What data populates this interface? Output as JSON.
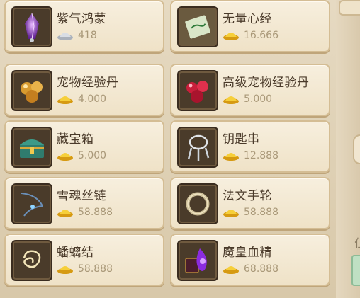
{
  "items": [
    {
      "name": "紫气鸿蒙",
      "price": "418",
      "currency": "silver",
      "icon": "purple-crystal-icon"
    },
    {
      "name": "无量心经",
      "price": "16.666",
      "currency": "gold",
      "icon": "scripture-scroll-icon"
    },
    {
      "name": "宠物经验丹",
      "price": "4.000",
      "currency": "gold",
      "icon": "gold-pills-icon"
    },
    {
      "name": "高级宠物经验丹",
      "price": "5.000",
      "currency": "gold",
      "icon": "red-pills-icon"
    },
    {
      "name": "藏宝箱",
      "price": "5.000",
      "currency": "gold",
      "icon": "treasure-chest-icon"
    },
    {
      "name": "钥匙串",
      "price": "12.888",
      "currency": "gold",
      "icon": "key-ring-icon"
    },
    {
      "name": "雪魂丝链",
      "price": "58.888",
      "currency": "gold",
      "icon": "silk-chain-icon"
    },
    {
      "name": "法文手轮",
      "price": "58.888",
      "currency": "gold",
      "icon": "bracelet-icon"
    },
    {
      "name": "蟠螭结",
      "price": "58.888",
      "currency": "gold",
      "icon": "dragon-knot-icon"
    },
    {
      "name": "魔皇血精",
      "price": "68.888",
      "currency": "gold",
      "icon": "blood-essence-icon"
    }
  ],
  "side": {
    "glyph": "仩"
  },
  "colors": {
    "gold": "#f2c12e",
    "silver": "#c9ced6",
    "text": "#4a3a2a",
    "price": "#a99878"
  }
}
